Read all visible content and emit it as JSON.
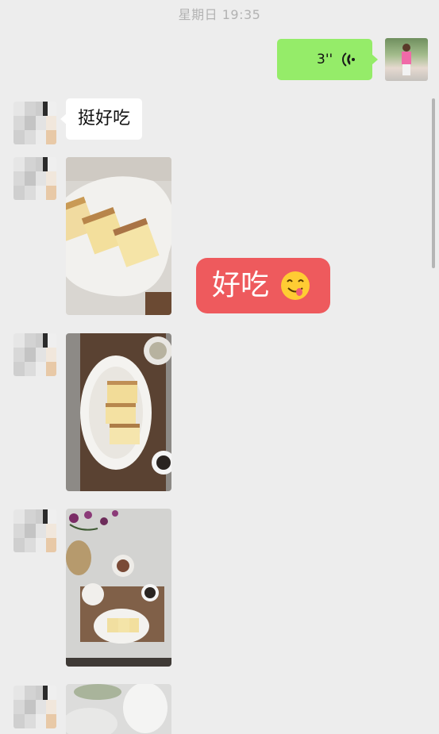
{
  "chat": {
    "timestamp": "星期日 19:35",
    "voice_message": {
      "duration": "3''"
    },
    "text_message": "挺好吃",
    "sticker": {
      "text": "好吃",
      "emoji": "yum-face-emoji"
    },
    "photo_messages": [
      {
        "description_icon": "cake-slices-photo"
      },
      {
        "description_icon": "cake-tray-photo"
      },
      {
        "description_icon": "table-setting-photo"
      },
      {
        "description_icon": "blurred-photo"
      }
    ]
  },
  "colors": {
    "background": "#ededed",
    "sent_bubble": "#95ec69",
    "received_bubble": "#ffffff",
    "sticker_bg": "#ee5a5d",
    "timestamp_text": "#b2b2b2"
  }
}
